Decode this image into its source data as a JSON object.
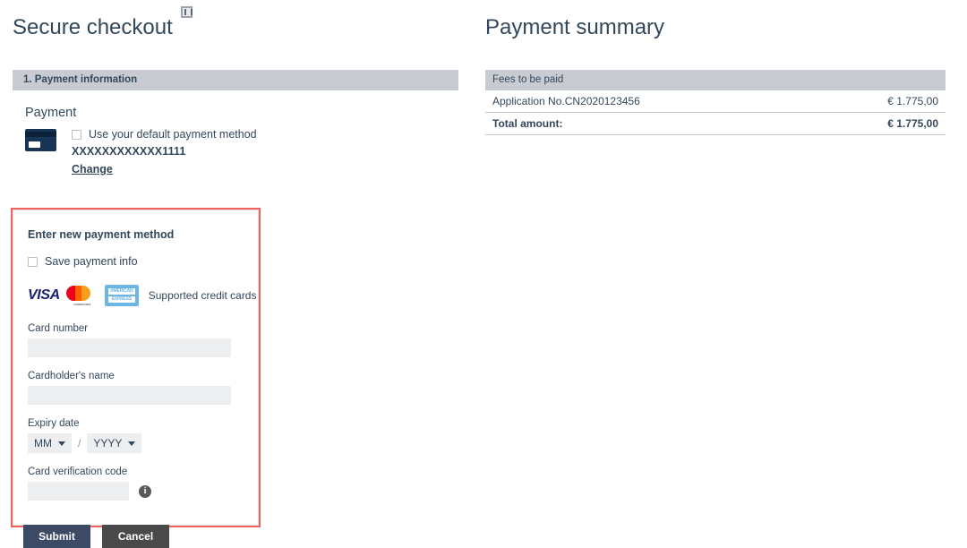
{
  "checkout": {
    "title": "Secure checkout",
    "title_icon": "broken-image-icon",
    "section_header": "1. Payment information",
    "payment_label": "Payment",
    "default_method": {
      "card_icon": "credit-card-icon",
      "checkbox_label": "Use your default payment method",
      "masked_number": "XXXXXXXXXXXX1111",
      "change_link": "Change",
      "checked": false
    },
    "new_method": {
      "heading": "Enter new payment method",
      "save_info_label": "Save payment info",
      "save_info_checked": false,
      "brands": [
        {
          "name": "visa-logo",
          "text": "VISA"
        },
        {
          "name": "mastercard-logo",
          "text": "mastercard"
        },
        {
          "name": "amex-logo",
          "line1": "AMERICAN",
          "line2": "EXPRESS"
        }
      ],
      "brands_caption": "Supported credit cards",
      "card_number_label": "Card number",
      "card_number_value": "",
      "cardholder_label": "Cardholder's name",
      "cardholder_value": "",
      "expiry_label": "Expiry date",
      "expiry_month": "MM",
      "expiry_separator": "/",
      "expiry_year": "YYYY",
      "cvc_label": "Card verification code",
      "cvc_value": "",
      "cvc_info_icon": "info-icon"
    },
    "buttons": {
      "submit": "Submit",
      "cancel": "Cancel"
    }
  },
  "summary": {
    "title": "Payment summary",
    "table_header": "Fees to be paid",
    "rows": [
      {
        "label": "Application No.CN2020123456",
        "amount": "€ 1.775,00"
      }
    ],
    "total_label": "Total amount:",
    "total_amount": "€ 1.775,00"
  },
  "colors": {
    "text": "#33475b",
    "bar": "#c8ccd2",
    "highlight": "#f0635c",
    "submit": "#3d4a66",
    "cancel": "#4a4a4a",
    "input": "#eceef0"
  }
}
